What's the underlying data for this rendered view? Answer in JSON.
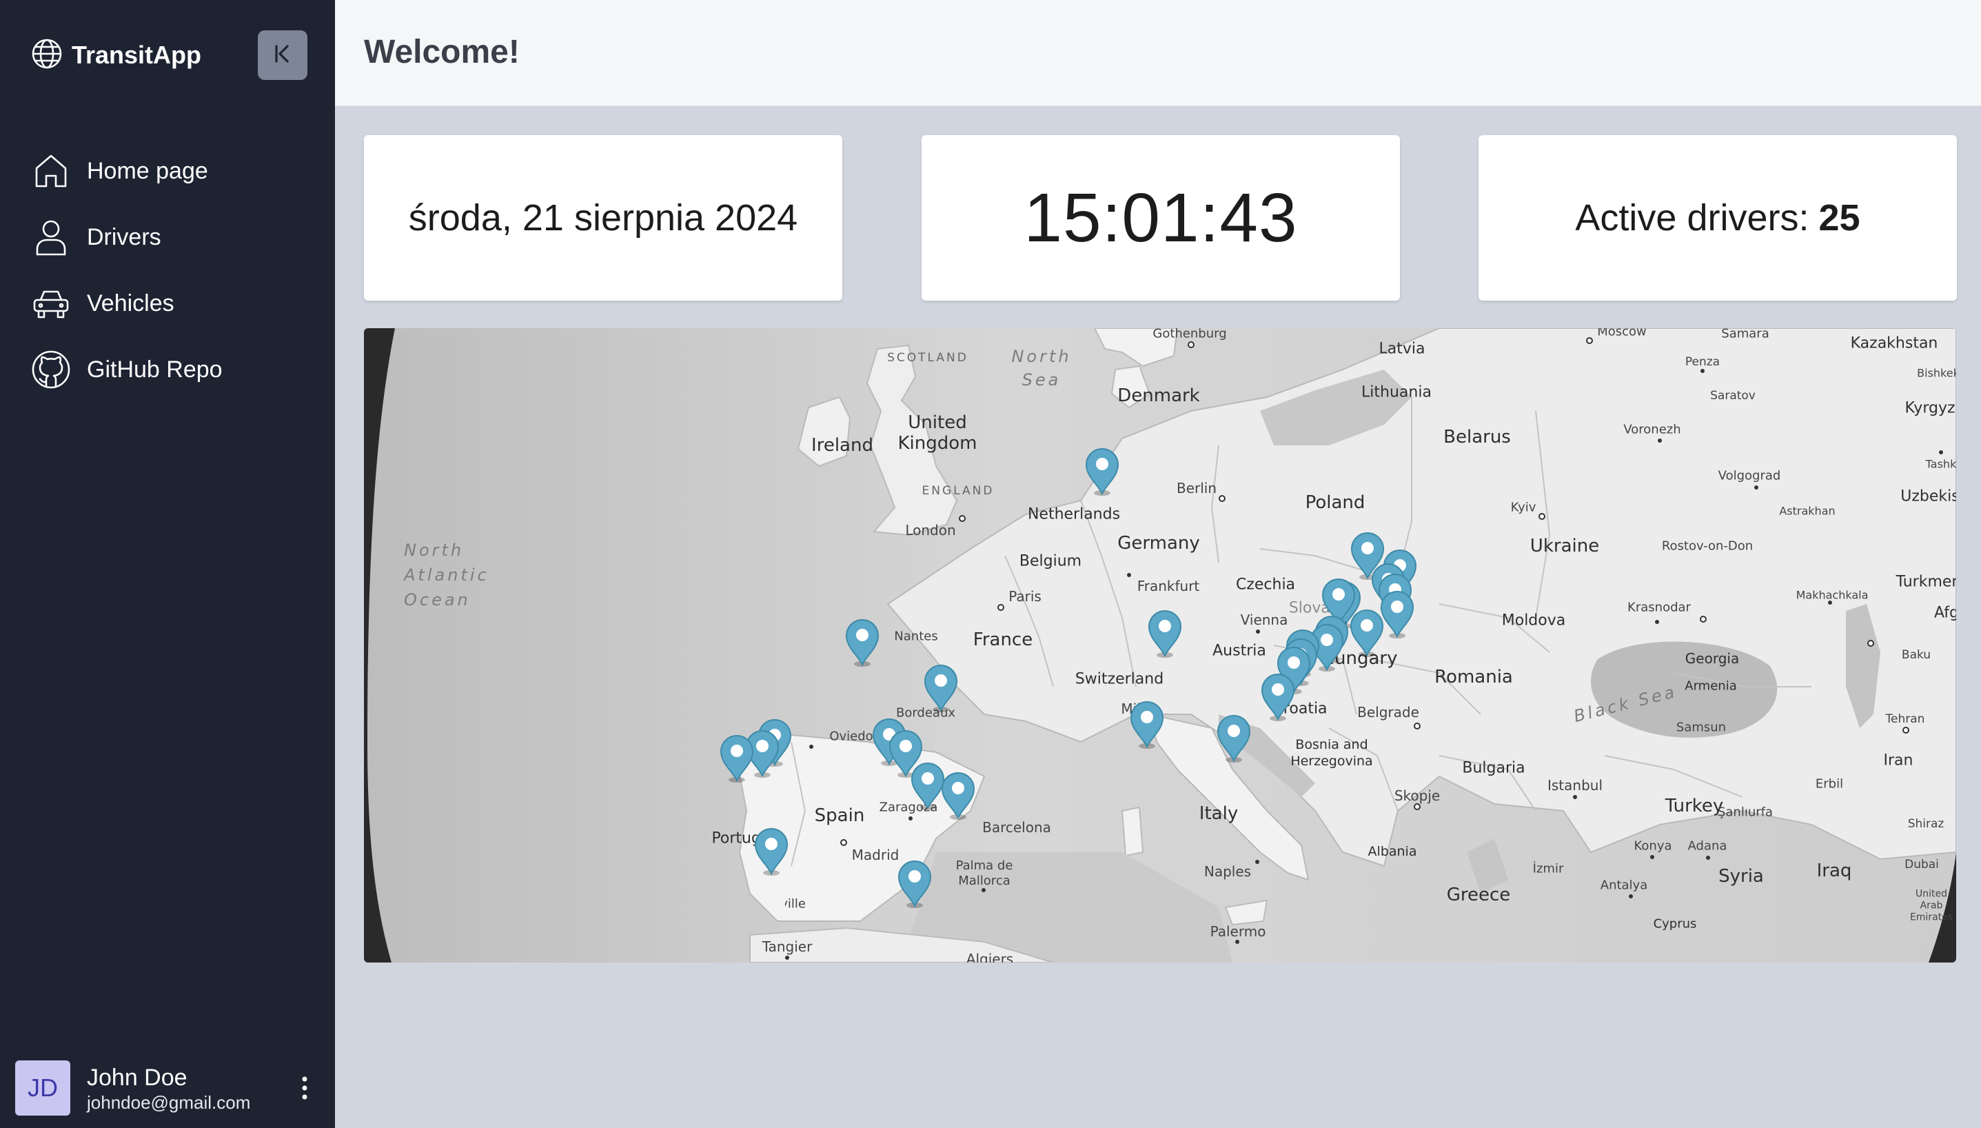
{
  "app": {
    "name": "TransitApp"
  },
  "nav": {
    "items": [
      {
        "label": "Home page",
        "icon": "home-icon"
      },
      {
        "label": "Drivers",
        "icon": "user-icon"
      },
      {
        "label": "Vehicles",
        "icon": "car-icon"
      },
      {
        "label": "GitHub Repo",
        "icon": "github-icon"
      }
    ]
  },
  "user": {
    "initials": "JD",
    "name": "John Doe",
    "email": "johndoe@gmail.com"
  },
  "header": {
    "title": "Welcome!"
  },
  "stats": {
    "date": "środa, 21 sierpnia 2024",
    "time": "15:01:43",
    "drivers_label": "Active drivers:",
    "drivers_count": "25"
  },
  "map": {
    "countries": [
      "Ireland",
      "United Kingdom",
      "Denmark",
      "Latvia",
      "Lithuania",
      "Belarus",
      "Netherlands",
      "Belgium",
      "Germany",
      "Poland",
      "Czechia",
      "Slovakia",
      "Ukraine",
      "France",
      "Switzerland",
      "Austria",
      "Hungary",
      "Moldova",
      "Romania",
      "Croatia",
      "Bosnia and Herzegovina",
      "Italy",
      "Spain",
      "Portugal",
      "Bulgaria",
      "Albania",
      "Greece",
      "Turkey",
      "Georgia",
      "Armenia",
      "Syria",
      "Iraq",
      "Iran",
      "Kazakhstan",
      "Kyrgyz",
      "Uzbekis",
      "Turkmen",
      "Afg",
      "Cyprus"
    ],
    "cities": [
      "Gothenburg",
      "Moscow",
      "Samara",
      "Penza",
      "Saratov",
      "Bishkek",
      "Voronezh",
      "Volgograd",
      "Astrakhan",
      "Tashk",
      "Rostov-on-Don",
      "Krasnodar",
      "Makhachkala",
      "Baku",
      "Tehran",
      "Samsun",
      "Erbil",
      "Shiraz",
      "Dubai",
      "United Arab Emirates",
      "London",
      "Berlin",
      "Kyiv",
      "Paris",
      "Frankfurt",
      "Vienna",
      "Nantes",
      "Bordeaux",
      "Milan",
      "Belgrade",
      "Oviedo",
      "Zaragoza",
      "Barcelona",
      "Madrid",
      "Palma de Mallorca",
      "Skopje",
      "Istanbul",
      "Şanlıurfa",
      "Konya",
      "Adana",
      "Antalya",
      "İzmir",
      "Naples",
      "Palermo",
      "Algiers",
      "Tangier",
      "Seville"
    ],
    "regions": [
      "SCOTLAND",
      "ENGLAND"
    ],
    "seas": [
      "North Sea",
      "North Atlantic Ocean",
      "Black Sea"
    ],
    "pin_count": 25,
    "pin_color": "#5ba8c8"
  }
}
